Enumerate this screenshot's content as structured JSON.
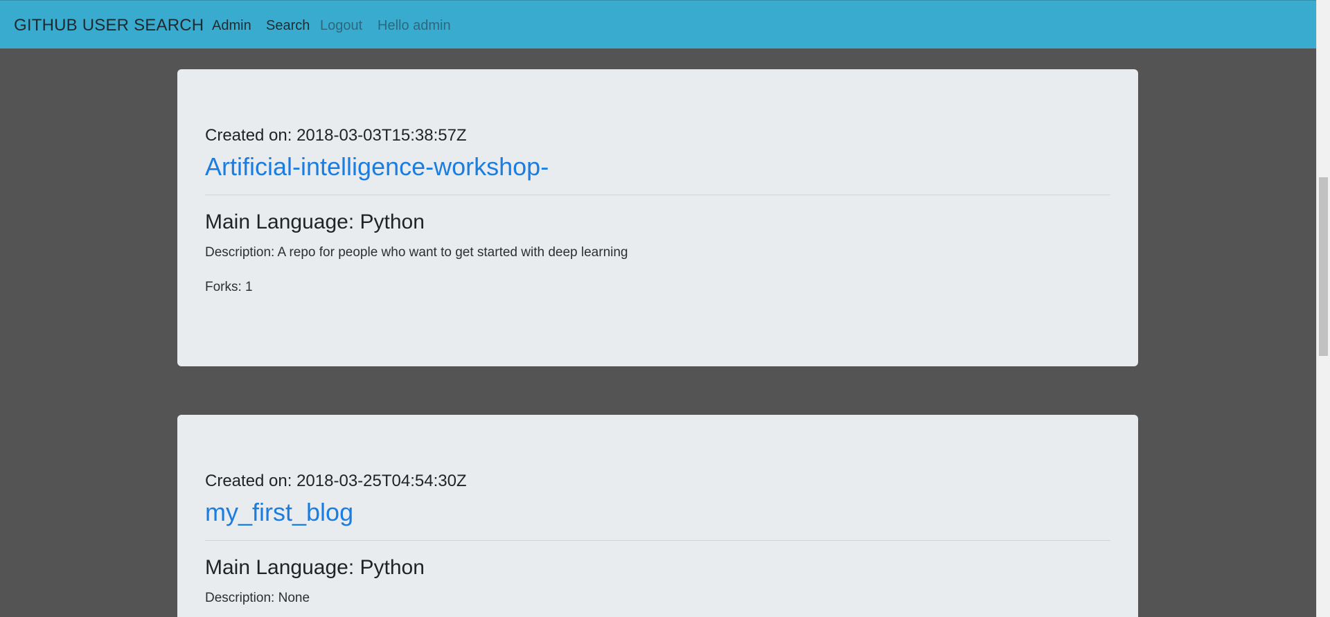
{
  "navbar": {
    "brand": "GITHUB USER SEARCH",
    "links": [
      "Admin",
      "Search",
      "Logout"
    ],
    "greeting": "Hello admin",
    "background_color": "#38abce"
  },
  "repos": [
    {
      "created": "Created on: 2018-03-03T15:38:57Z",
      "name": "Artificial-intelligence-workshop-",
      "language": "Main Language: Python",
      "description": "Description: A repo for people who want to get started with deep learning",
      "forks": "Forks: 1"
    },
    {
      "created": "Created on: 2018-03-25T04:54:30Z",
      "name": "my_first_blog",
      "language": "Main Language: Python",
      "description": "Description: None"
    }
  ],
  "colors": {
    "page_background": "#545454",
    "card_background": "#e8ecef",
    "link": "#1a7ddf"
  }
}
